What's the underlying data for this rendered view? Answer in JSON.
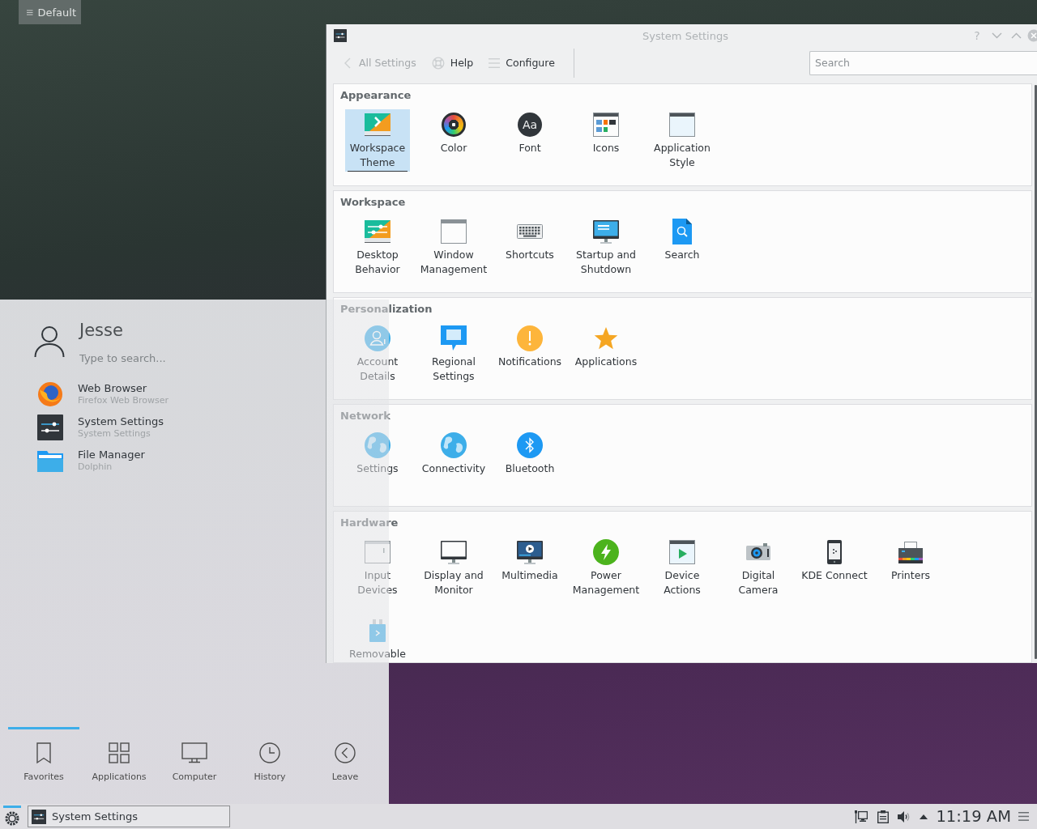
{
  "desktop": {
    "activity_button": {
      "label": "Default"
    }
  },
  "settings_window": {
    "title": "System Settings",
    "help_button": "?",
    "toolbar": [
      {
        "label": "All Settings",
        "disabled": true
      },
      {
        "label": "Help",
        "disabled": false
      },
      {
        "label": "Configure",
        "disabled": false
      }
    ],
    "search": {
      "placeholder": "Search"
    },
    "sections": [
      {
        "title": "Appearance",
        "items": [
          {
            "label": "Workspace\nTheme",
            "selected": true
          },
          {
            "label": "Color",
            "selected": false
          },
          {
            "label": "Font",
            "glyph": "Aa",
            "selected": false
          },
          {
            "label": "Icons",
            "selected": false
          },
          {
            "label": "Application\nStyle",
            "selected": false
          }
        ]
      },
      {
        "title": "Workspace",
        "items": [
          {
            "label": "Desktop\nBehavior",
            "selected": false
          },
          {
            "label": "Window\nManagement",
            "selected": false
          },
          {
            "label": "Shortcuts",
            "selected": false
          },
          {
            "label": "Startup and\nShutdown",
            "selected": false
          },
          {
            "label": "Search",
            "selected": false
          }
        ]
      },
      {
        "title": "Personalization",
        "items": [
          {
            "label": "Account\nDetails",
            "selected": false
          },
          {
            "label": "Regional\nSettings",
            "selected": false
          },
          {
            "label": "Notifications",
            "selected": false
          },
          {
            "label": "Applications",
            "selected": false
          }
        ]
      },
      {
        "title": "Network",
        "items": [
          {
            "label": "Settings",
            "selected": false
          },
          {
            "label": "Connectivity",
            "selected": false
          },
          {
            "label": "Bluetooth",
            "selected": false
          }
        ]
      },
      {
        "title": "Hardware",
        "items": [
          {
            "label": "Input\nDevices",
            "selected": false
          },
          {
            "label": "Display and\nMonitor",
            "selected": false
          },
          {
            "label": "Multimedia",
            "selected": false
          },
          {
            "label": "Power\nManagement",
            "selected": false
          },
          {
            "label": "Device\nActions",
            "selected": false
          },
          {
            "label": "Digital\nCamera",
            "selected": false
          },
          {
            "label": "KDE Connect",
            "selected": false
          },
          {
            "label": "Printers",
            "selected": false
          },
          {
            "label": "Removable",
            "selected": false
          }
        ]
      }
    ]
  },
  "launcher": {
    "user": {
      "name": "Jesse"
    },
    "search": {
      "placeholder": "Type to search..."
    },
    "favorites": [
      {
        "name": "Web Browser",
        "description": "Firefox Web Browser"
      },
      {
        "name": "System Settings",
        "description": "System Settings"
      },
      {
        "name": "File Manager",
        "description": "Dolphin"
      }
    ],
    "tabs": [
      {
        "label": "Favorites",
        "selected": true
      },
      {
        "label": "Applications",
        "selected": false
      },
      {
        "label": "Computer",
        "selected": false
      },
      {
        "label": "History",
        "selected": false
      },
      {
        "label": "Leave",
        "selected": false
      }
    ]
  },
  "taskbar": {
    "launcher_button": {
      "active": true
    },
    "tasks": [
      {
        "title": "System Settings"
      }
    ],
    "clock": "11:19 AM"
  }
}
